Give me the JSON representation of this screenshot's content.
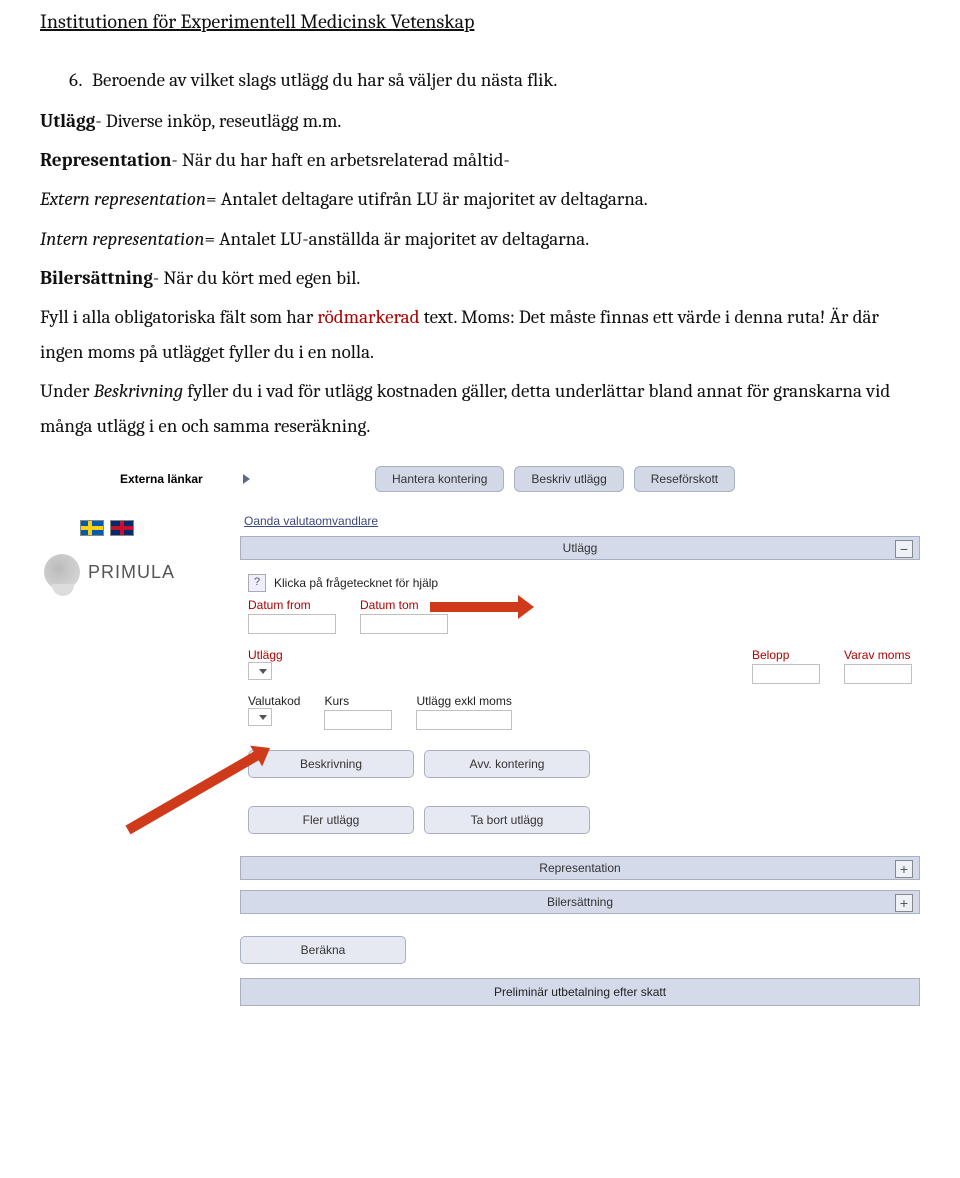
{
  "doc": {
    "header": "Institutionen för Experimentell Medicinsk Vetenskap",
    "step_num": "6.",
    "step_text": "Beroende av vilket slags utlägg du har så väljer du nästa flik.",
    "line_utlagg_b": "Utlägg",
    "line_utlagg_rest": "- Diverse inköp, reseutlägg m.m.",
    "line_rep_b": "Representation",
    "line_rep_rest": "- När du har haft en arbetsrelaterad måltid-",
    "line_rep_ext_i": "Extern representation",
    "line_rep_ext_rest": "= Antalet deltagare utifrån LU är majoritet av deltagarna.",
    "line_rep_int_i": "Intern representation",
    "line_rep_int_rest": "= Antalet LU-anställda är majoritet av deltagarna.",
    "line_biler_b": "Bilersättning",
    "line_biler_rest": "- När du kört med egen bil.",
    "para2_a": "Fyll i alla obligatoriska fält som har ",
    "para2_red": "rödmarkerad",
    "para2_b": " text. Moms: Det måste finnas ett värde i denna ruta! Är där ingen moms på utlägget fyller du i en nolla.",
    "para3_a": "Under ",
    "para3_i": "Beskrivning",
    "para3_b": " fyller du i vad för utlägg kostnaden gäller, detta underlättar bland annat för granskarna vid många utlägg i en och samma reseräkning."
  },
  "app": {
    "external_links": "Externa länkar",
    "btn_kontering": "Hantera kontering",
    "btn_beskriv": "Beskriv utlägg",
    "btn_reseforskott": "Reseförskott",
    "logo_text": "PRIMULA",
    "link_oanda": "Oanda valutaomvandlare",
    "section_utlagg": "Utlägg",
    "help_text": "Klicka på frågetecknet för hjälp",
    "label_datum_from": "Datum from",
    "label_datum_tom": "Datum tom",
    "label_utlagg": "Utlägg",
    "label_belopp": "Belopp",
    "label_varav_moms": "Varav moms",
    "label_valutakod": "Valutakod",
    "label_kurs": "Kurs",
    "label_utlagg_exkl": "Utlägg exkl moms",
    "btn_beskrivning": "Beskrivning",
    "btn_avv_kontering": "Avv. kontering",
    "btn_fler_utlagg": "Fler utlägg",
    "btn_ta_bort": "Ta bort utlägg",
    "section_representation": "Representation",
    "section_bilersattning": "Bilersättning",
    "btn_berakna": "Beräkna",
    "prelim_bar": "Preliminär utbetalning efter skatt"
  }
}
